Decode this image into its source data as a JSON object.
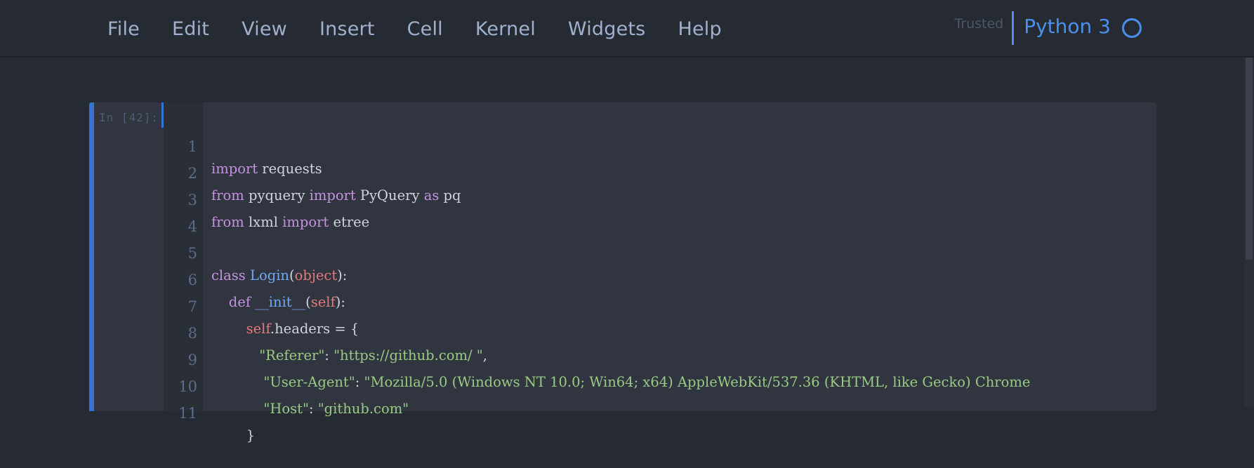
{
  "menu": {
    "items": [
      "File",
      "Edit",
      "View",
      "Insert",
      "Cell",
      "Kernel",
      "Widgets",
      "Help"
    ]
  },
  "kernel": {
    "trusted_label": "Trusted",
    "name": "Python 3",
    "status_icon": "idle-circle-icon"
  },
  "cell": {
    "prompt": "In [42]:",
    "line_numbers": [
      "1",
      "2",
      "3",
      "4",
      "5",
      "6",
      "7",
      "8",
      "9",
      "10",
      "11"
    ],
    "lines": {
      "l1": {
        "kw1": "import",
        "t1": " requests"
      },
      "l2": {
        "kw1": "from",
        "t1": " pyquery ",
        "kw2": "import",
        "t2": " PyQuery ",
        "kw3": "as",
        "t3": " pq"
      },
      "l3": {
        "kw1": "from",
        "t1": " lxml ",
        "kw2": "import",
        "t2": " etree"
      },
      "l4": {
        "t1": ""
      },
      "l5": {
        "kw1": "class",
        "t0": " ",
        "cls": "Login",
        "p1": "(",
        "bi": "object",
        "p2": "):"
      },
      "l6": {
        "indent": "    ",
        "kw1": "def",
        "t0": " ",
        "cls": "__init__",
        "p1": "(",
        "bi": "self",
        "p2": "):"
      },
      "l7": {
        "indent": "        ",
        "bi": "self",
        "t1": ".headers = {"
      },
      "l8": {
        "indent": "           ",
        "s1": "\"Referer\"",
        "t1": ": ",
        "s2": "\"https://github.com/ \"",
        "t2": ","
      },
      "l9": {
        "indent": "            ",
        "s1": "\"User-Agent\"",
        "t1": ": ",
        "s2": "\"Mozilla/5.0 (Windows NT 10.0; Win64; x64) AppleWebKit/537.36 (KHTML, like Gecko) Chrome"
      },
      "l10": {
        "indent": "            ",
        "s1": "\"Host\"",
        "t1": ": ",
        "s2": "\"github.com\""
      },
      "l11": {
        "indent": "        ",
        "t1": "}"
      }
    }
  },
  "colors": {
    "background": "#262a33",
    "cell_background": "#30353f",
    "accent": "#3673d6",
    "kernel_blue": "#4a90ee",
    "keyword": "#c592e0",
    "class_name": "#73a8f2",
    "builtin": "#e27b7b",
    "string": "#9acb85"
  }
}
